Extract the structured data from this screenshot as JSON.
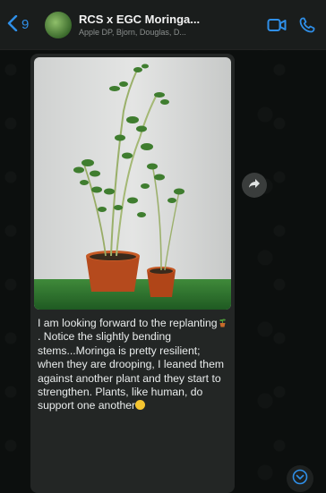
{
  "header": {
    "back_count": "9",
    "title": "RCS x EGC Moringa...",
    "subtitle": "Apple DP, Bjorn, Douglas, D..."
  },
  "message": {
    "line1": "I am looking forward to the replanting",
    "line2": ". Notice the slightly bending stems...Moringa is pretty resilient; when they are drooping, I leaned them against another plant and they start to strengthen. Plants, like human, do support one another"
  },
  "colors": {
    "accent": "#2f8fe8",
    "header_bg": "#1a1d1c",
    "bubble_bg": "#232625"
  },
  "icons": {
    "back": "chevron-left-icon",
    "video": "video-call-icon",
    "phone": "phone-icon",
    "forward": "forward-icon",
    "scroll": "scroll-down-icon"
  }
}
